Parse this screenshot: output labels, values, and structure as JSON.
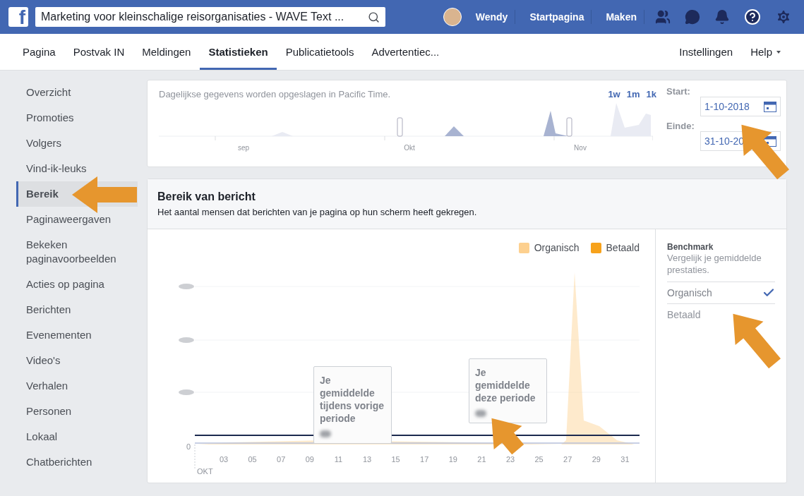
{
  "top_bar": {
    "logo": "f",
    "search": {
      "value": "Marketing voor kleinschalige reisorganisaties - WAVE Text ..."
    },
    "user": "Wendy",
    "links": [
      "Startpagina",
      "Maken"
    ]
  },
  "tabs": [
    {
      "label": "Pagina",
      "selected": false
    },
    {
      "label": "Postvak IN",
      "selected": false
    },
    {
      "label": "Meldingen",
      "selected": false
    },
    {
      "label": "Statistieken",
      "selected": true
    },
    {
      "label": "Publicatietools",
      "selected": false
    },
    {
      "label": "Advertentiec...",
      "selected": false
    }
  ],
  "right_tabs": [
    {
      "label": "Instellingen",
      "caret": false
    },
    {
      "label": "Help",
      "caret": true
    }
  ],
  "sidebar": {
    "items": [
      {
        "label": "Overzicht",
        "selected": false
      },
      {
        "label": "Promoties",
        "selected": false
      },
      {
        "label": "Volgers",
        "selected": false
      },
      {
        "label": "Vind-ik-leuks",
        "selected": false
      },
      {
        "label": "Bereik",
        "selected": true
      },
      {
        "label": "Paginaweergaven",
        "selected": false
      },
      {
        "label": "Bekeken paginavoorbeelden",
        "selected": false
      },
      {
        "label": "Acties op pagina",
        "selected": false
      },
      {
        "label": "Berichten",
        "selected": false
      },
      {
        "label": "Evenementen",
        "selected": false
      },
      {
        "label": "Video's",
        "selected": false
      },
      {
        "label": "Verhalen",
        "selected": false
      },
      {
        "label": "Personen",
        "selected": false
      },
      {
        "label": "Lokaal",
        "selected": false
      },
      {
        "label": "Chatberichten",
        "selected": false
      }
    ]
  },
  "timeline": {
    "note": "Dagelijkse gegevens worden opgeslagen in Pacific Time.",
    "ranges": [
      "1w",
      "1m",
      "1k"
    ],
    "months": [
      "sep",
      "Okt",
      "Nov"
    ],
    "start": {
      "label": "Start:",
      "value": "1-10-2018"
    },
    "end": {
      "label": "Einde:",
      "value": "31-10-20"
    }
  },
  "reach": {
    "title": "Bereik van bericht",
    "subtitle": "Het aantal mensen dat berichten van je pagina op hun scherm heeft gekregen.",
    "legend": [
      {
        "label": "Organisch",
        "color": "#fdd08f"
      },
      {
        "label": "Betaald",
        "color": "#f7a21b"
      }
    ],
    "y_zero": "0",
    "x_labels": [
      "03",
      "05",
      "07",
      "09",
      "11",
      "13",
      "15",
      "17",
      "19",
      "21",
      "23",
      "25",
      "27",
      "29",
      "31"
    ],
    "x_month": "OKT",
    "callouts": [
      "Je gemiddelde tijdens vorige periode",
      "Je gemiddelde deze periode"
    ],
    "benchmark": {
      "title": "Benchmark",
      "description": "Vergelijk je gemiddelde prestaties.",
      "options": [
        {
          "label": "Organisch",
          "selected": true
        },
        {
          "label": "Betaald",
          "selected": false
        }
      ]
    }
  }
}
